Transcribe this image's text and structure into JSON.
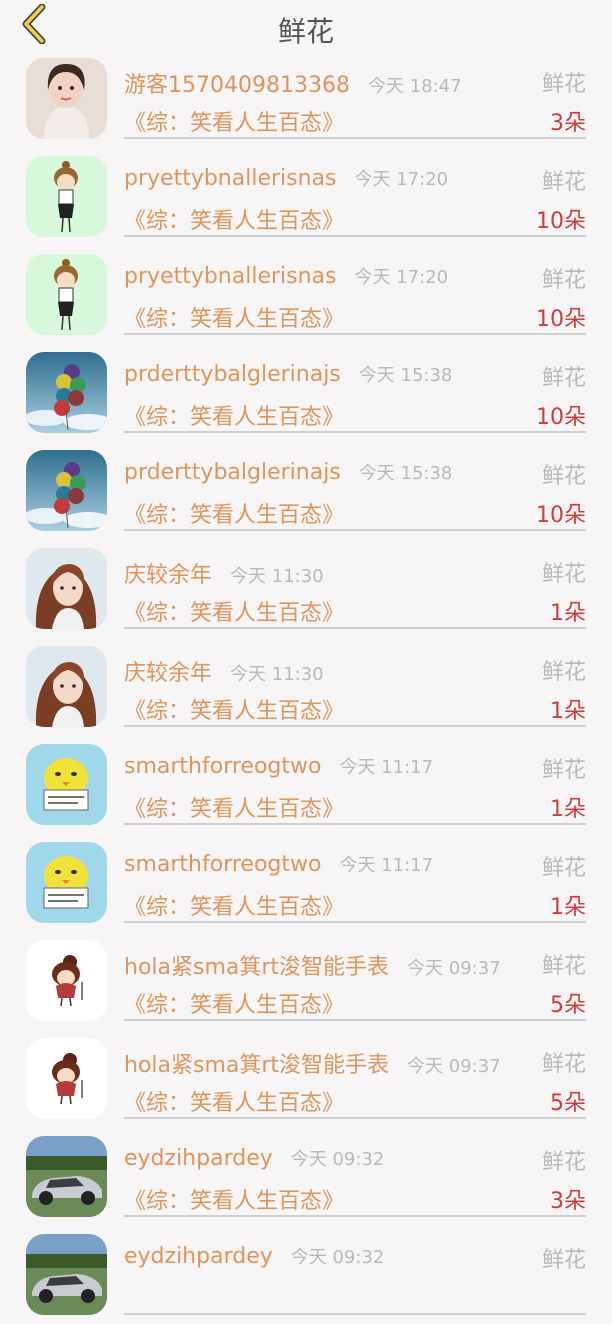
{
  "header": {
    "title": "鲜花"
  },
  "rows": [
    {
      "name": "游客1570409813368",
      "time": "今天 18:47",
      "type": "鲜花",
      "book": "《综：笑看人生百态》",
      "count": "3朵",
      "avatar": "woman-portrait-avatar"
    },
    {
      "name": "pryettybnallerisnas",
      "time": "今天 17:20",
      "type": "鲜花",
      "book": "《综：笑看人生百态》",
      "count": "10朵",
      "avatar": "cartoon-girl-avatar"
    },
    {
      "name": "pryettybnallerisnas",
      "time": "今天 17:20",
      "type": "鲜花",
      "book": "《综：笑看人生百态》",
      "count": "10朵",
      "avatar": "cartoon-girl-avatar"
    },
    {
      "name": "prderttybalglerinajs",
      "time": "今天 15:38",
      "type": "鲜花",
      "book": "《综：笑看人生百态》",
      "count": "10朵",
      "avatar": "balloons-avatar"
    },
    {
      "name": "prderttybalglerinajs",
      "time": "今天 15:38",
      "type": "鲜花",
      "book": "《综：笑看人生百态》",
      "count": "10朵",
      "avatar": "balloons-avatar"
    },
    {
      "name": "庆较余年",
      "time": "今天 11:30",
      "type": "鲜花",
      "book": "《综：笑看人生百态》",
      "count": "1朵",
      "avatar": "girl-photo-avatar"
    },
    {
      "name": "庆较余年",
      "time": "今天 11:30",
      "type": "鲜花",
      "book": "《综：笑看人生百态》",
      "count": "1朵",
      "avatar": "girl-photo-avatar"
    },
    {
      "name": "smarthforreogtwo",
      "time": "今天 11:17",
      "type": "鲜花",
      "book": "《综：笑看人生百态》",
      "count": "1朵",
      "avatar": "yellow-chick-avatar"
    },
    {
      "name": "smarthforreogtwo",
      "time": "今天 11:17",
      "type": "鲜花",
      "book": "《综：笑看人生百态》",
      "count": "1朵",
      "avatar": "yellow-chick-avatar"
    },
    {
      "name": "hola紧sma箕rt浚智能手表",
      "time": "今天 09:37",
      "type": "鲜花",
      "book": "《综：笑看人生百态》",
      "count": "5朵",
      "avatar": "cartoon-doll-avatar"
    },
    {
      "name": "hola紧sma箕rt浚智能手表",
      "time": "今天 09:37",
      "type": "鲜花",
      "book": "《综：笑看人生百态》",
      "count": "5朵",
      "avatar": "cartoon-doll-avatar"
    },
    {
      "name": "eydzihpardey",
      "time": "今天 09:32",
      "type": "鲜花",
      "book": "《综：笑看人生百态》",
      "count": "3朵",
      "avatar": "car-avatar"
    },
    {
      "name": "eydzihpardey",
      "time": "今天 09:32",
      "type": "鲜花",
      "book": "",
      "count": "",
      "avatar": "car-avatar"
    }
  ]
}
